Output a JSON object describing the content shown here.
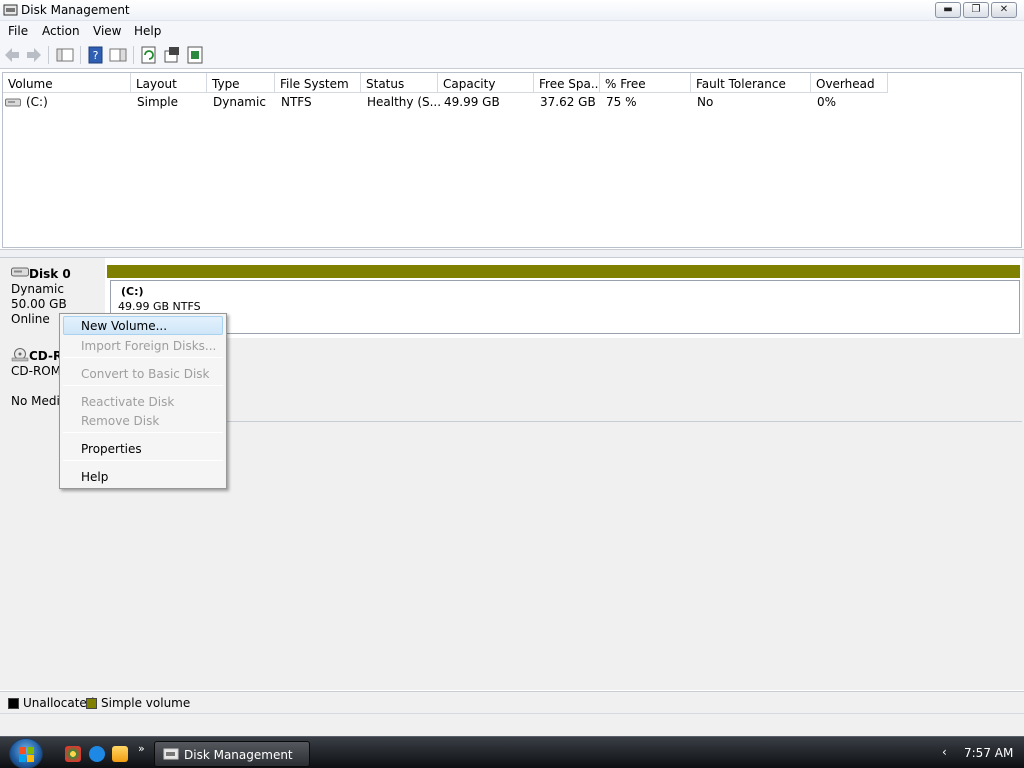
{
  "window": {
    "title": "Disk Management",
    "minimize_icon": "minimize-icon",
    "maximize_icon": "restore-icon",
    "close_icon": "close-icon"
  },
  "menu": [
    "File",
    "Action",
    "View",
    "Help"
  ],
  "toolbar": {
    "icons": [
      "back-arrow-icon",
      "forward-arrow-icon",
      "show-hide-console-tree-icon",
      "help-icon",
      "show-action-pane-icon",
      "refresh-icon",
      "properties-icon",
      "export-list-icon"
    ]
  },
  "volume_table": {
    "columns": [
      "Volume",
      "Layout",
      "Type",
      "File System",
      "Status",
      "Capacity",
      "Free Spa...",
      "% Free",
      "Fault Tolerance",
      "Overhead"
    ],
    "rows": [
      [
        "(C:)",
        "Simple",
        "Dynamic",
        "NTFS",
        "Healthy (S...",
        "49.99 GB",
        "37.62 GB",
        "75 %",
        "No",
        "0%"
      ]
    ]
  },
  "disks": [
    {
      "name": "Disk 0",
      "type": "Dynamic",
      "size": "50.00 GB",
      "status": "Online",
      "volume_name": "(C:)",
      "volume_detail": "49.99 GB NTFS"
    },
    {
      "name": "CD-R",
      "type": "CD-ROM",
      "status": "No Media"
    }
  ],
  "context_menu": {
    "items": [
      {
        "label": "New Volume...",
        "state": "highlighted"
      },
      {
        "label": "Import Foreign Disks...",
        "state": "disabled"
      },
      {
        "label": "Convert to Basic Disk",
        "state": "disabled"
      },
      {
        "label": "Reactivate Disk",
        "state": "disabled"
      },
      {
        "label": "Remove Disk",
        "state": "disabled"
      },
      {
        "label": "Properties",
        "state": "enabled"
      },
      {
        "label": "Help",
        "state": "enabled"
      }
    ]
  },
  "legend": [
    {
      "label": "Unallocated",
      "color": "#000000"
    },
    {
      "label": "Simple volume",
      "color": "#808000"
    }
  ],
  "taskbar": {
    "task_label": "Disk Management",
    "clock": "7:57 AM",
    "tray_arrow": "‹",
    "quicklaunch_chevron": "»"
  }
}
